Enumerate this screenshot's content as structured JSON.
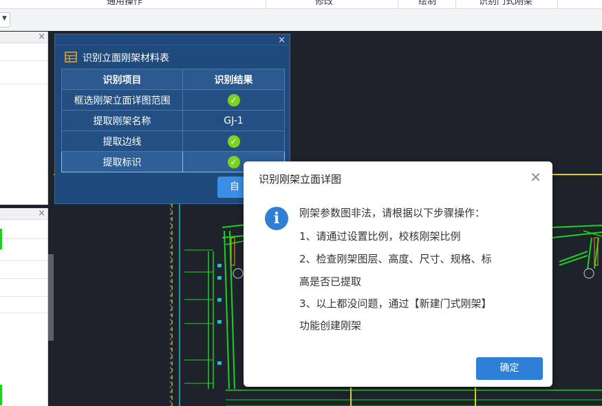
{
  "ribbon": {
    "groups": [
      "通用操作",
      "修改",
      "绘制",
      "识别门式刚架"
    ]
  },
  "material_panel": {
    "title": "识别立面刚架材料表",
    "columns": [
      "识别项目",
      "识别结果"
    ],
    "rows": [
      {
        "item": "框选刚架立面详图范围",
        "result": "",
        "ok": true
      },
      {
        "item": "提取刚架名称",
        "result": "GJ-1",
        "ok": false
      },
      {
        "item": "提取边线",
        "result": "",
        "ok": true
      },
      {
        "item": "提取标识",
        "result": "",
        "ok": true,
        "selected": true
      }
    ],
    "auto_button": "自动"
  },
  "dialog": {
    "title": "识别刚架立面详图",
    "lines": [
      "刚架参数图非法，请根据以下步骤操作：",
      "1、请通过设置比例，校核刚架比例",
      "2、检查刚架图层、高度、尺寸、规格、标",
      "高是否已提取",
      "3、以上都没问题，通过【新建门式刚架】",
      "功能创建刚架"
    ],
    "ok_button": "确定"
  },
  "icons": {
    "close": "close-icon",
    "info": "info-icon",
    "check": "check-icon",
    "dropdown": "chevron-down-icon",
    "table": "table-icon"
  },
  "colors": {
    "panel_bg": "#1f4a7c",
    "accent_blue": "#2f7fd6",
    "check_green": "#7ed321",
    "cad_bg": "#1e222a",
    "cad_line_green": "#1fd11f",
    "cad_line_yellow": "#e6d21a",
    "cad_line_cyan": "#2bb8c8"
  }
}
